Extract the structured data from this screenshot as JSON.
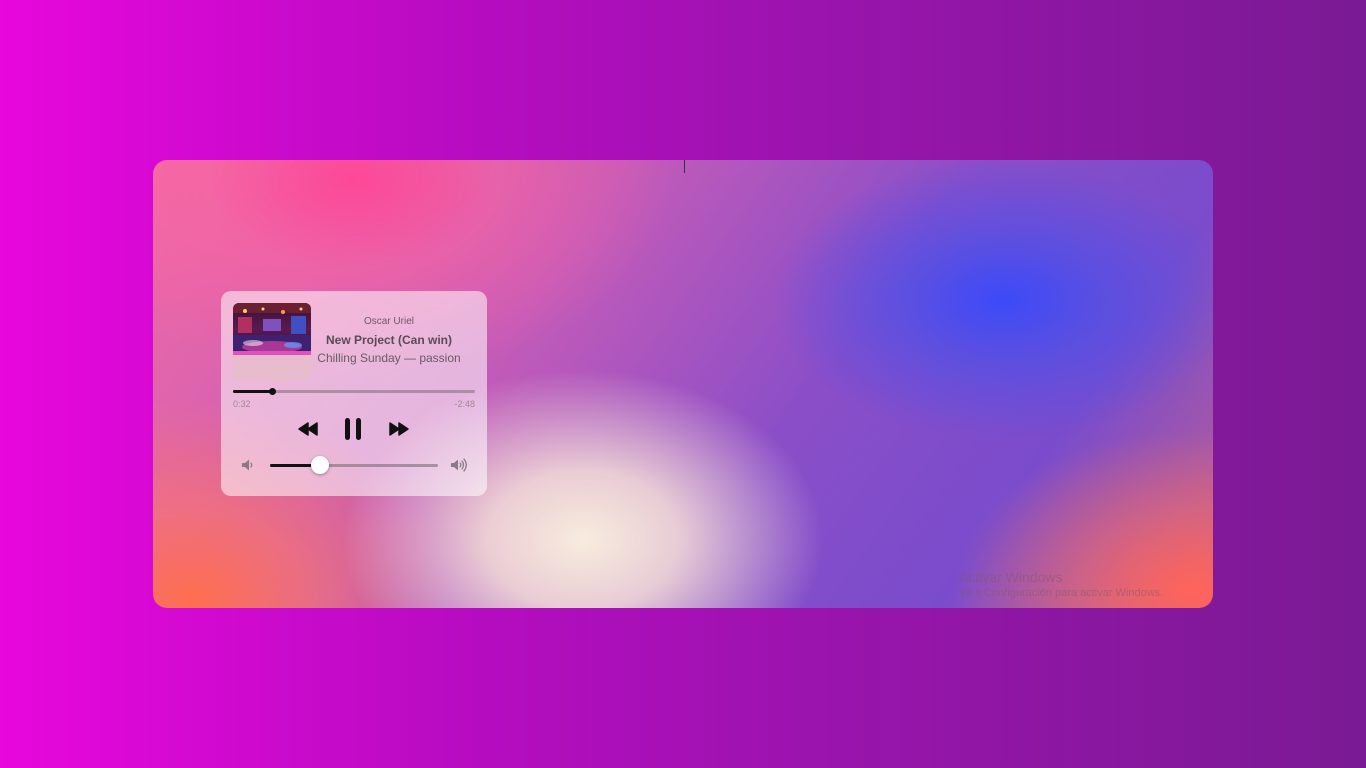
{
  "player": {
    "artist": "Oscar Uriel",
    "title": "New Project (Can win)",
    "album": "Chilling Sunday — passion",
    "album_art": "nightclub-photo",
    "elapsed": "0:32",
    "remaining": "-2:48",
    "progress": 0.16,
    "volume": 0.3,
    "icons": {
      "rewind": "rewind-icon",
      "pause": "pause-icon",
      "forward": "fast-forward-icon",
      "volume_low": "volume-low-icon",
      "volume_high": "volume-high-icon"
    }
  },
  "watermark": {
    "title": "Activar Windows",
    "subtitle": "Ve a Configuración para activar Windows."
  },
  "colors": {
    "background_start": "#e807dd",
    "background_end": "#7a1a94",
    "control": "#111111"
  }
}
